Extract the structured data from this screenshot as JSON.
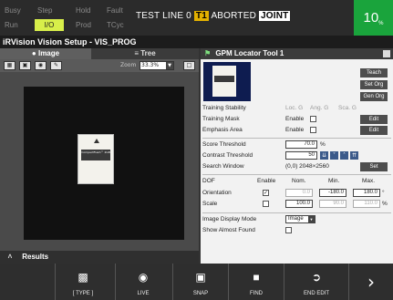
{
  "status": {
    "row1": [
      "Busy",
      "Step",
      "Hold",
      "Fault"
    ],
    "row2": [
      "Run",
      "I/O",
      "Prod",
      "TCyc"
    ],
    "active": "I/O",
    "line_prefix": "TEST LINE 0",
    "tool": "T1",
    "state": "ABORTED",
    "coord": "JOINT",
    "speed": "10",
    "speed_unit": "%"
  },
  "title": "iRVision Vision Setup - VIS_PROG",
  "left": {
    "tabs": {
      "image": "Image",
      "tree": "Tree"
    },
    "zoom_label": "Zoom",
    "zoom_value": "33.3%",
    "results_label": "Results",
    "card_text": "CompactFlash™\n2GB"
  },
  "right": {
    "header": "GPM Locator Tool 1",
    "buttons": {
      "teach": "Teach",
      "set_org": "Set Org",
      "gen_org": "Gen Org",
      "edit_mask": "Edit",
      "edit_emphasis": "Edit",
      "set_window": "Set"
    },
    "training_stability": {
      "label": "Training Stability",
      "loc": "Loc.",
      "loc_v": "G",
      "ang": "Ang.",
      "ang_v": "G",
      "sca": "Sca.",
      "sca_v": "G"
    },
    "training_mask": {
      "label": "Training Mask",
      "enable": "Enable"
    },
    "emphasis_area": {
      "label": "Emphasis Area",
      "enable": "Enable"
    },
    "score_threshold": {
      "label": "Score Threshold",
      "value": "70.0",
      "unit": "%"
    },
    "contrast_threshold": {
      "label": "Contrast Threshold",
      "value": "50"
    },
    "search_window": {
      "label": "Search Window",
      "value": "(0,0) 2048×2560"
    },
    "dof": {
      "headers": {
        "dof": "DOF",
        "enable": "Enable",
        "nom": "Nom.",
        "min": "Min.",
        "max": "Max."
      },
      "orientation": {
        "label": "Orientation",
        "checked": true,
        "nom": "0.0",
        "min": "-180.0",
        "max": "180.0",
        "unit": "°"
      },
      "scale": {
        "label": "Scale",
        "checked": false,
        "nom": "100.0",
        "min": "90.0",
        "max": "110.0",
        "unit": "%"
      }
    },
    "image_display_mode": {
      "label": "Image Display Mode",
      "value": "Image"
    },
    "show_almost_found": {
      "label": "Show Almost Found"
    }
  },
  "function_keys": [
    {
      "label": "[ TYPE ]",
      "icon": "type-icon"
    },
    {
      "label": "LIVE",
      "icon": "camera-live-icon"
    },
    {
      "label": "SNAP",
      "icon": "camera-snap-icon"
    },
    {
      "label": "FIND",
      "icon": "find-icon"
    },
    {
      "label": "END EDIT",
      "icon": "exit-icon"
    }
  ],
  "colors": {
    "status_active": "#d8ef4a",
    "speed_bg": "#1aa43c",
    "t1_bg": "#e3b100"
  }
}
